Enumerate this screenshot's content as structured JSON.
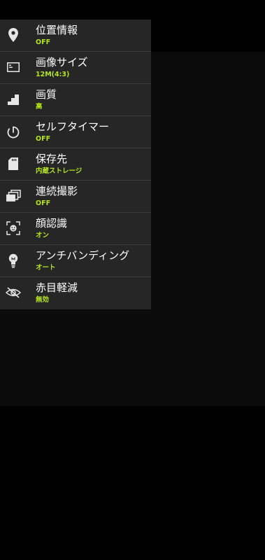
{
  "settings": {
    "items": [
      {
        "icon": "location-pin-icon",
        "title": "位置情報",
        "value": "OFF"
      },
      {
        "icon": "image-size-icon",
        "title": "画像サイズ",
        "value": "12M(4:3)"
      },
      {
        "icon": "image-quality-icon",
        "title": "画質",
        "value": "高"
      },
      {
        "icon": "self-timer-icon",
        "title": "セルフタイマー",
        "value": "OFF"
      },
      {
        "icon": "sd-card-icon",
        "title": "保存先",
        "value": "内蔵ストレージ"
      },
      {
        "icon": "burst-shot-icon",
        "title": "連続撮影",
        "value": "OFF"
      },
      {
        "icon": "face-detection-icon",
        "title": "顔認識",
        "value": "オン"
      },
      {
        "icon": "antibanding-bulb-icon",
        "title": "アンチバンディング",
        "value": "オート"
      },
      {
        "icon": "red-eye-icon",
        "title": "赤目軽減",
        "value": "無効"
      }
    ]
  },
  "colors": {
    "panel": "#262626",
    "value_accent": "#b5e61d",
    "text": "#ffffff",
    "background": "#000000"
  }
}
